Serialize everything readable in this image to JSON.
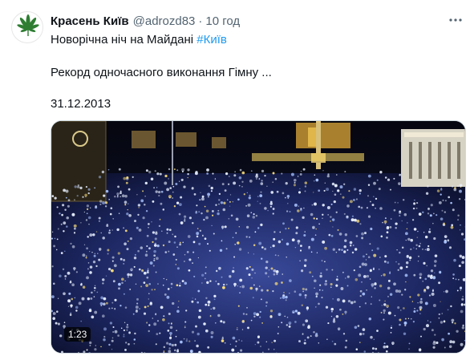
{
  "tweet": {
    "author_name": "Красень Київ",
    "handle": "@adrozd83",
    "separator": "·",
    "time": "10 год",
    "line1_text": "Новорічна ніч на Майдані ",
    "hashtag": "#Київ",
    "line2_text": "Рекорд одночасного виконання Гімну ...",
    "line3_text": "31.12.2013",
    "avatar_icon": "cannabis-leaf-icon",
    "more_icon": "more-options-icon"
  },
  "media": {
    "duration": "1:23",
    "play_state": "video-thumbnail"
  },
  "colors": {
    "hashtag": "#1d9bf0",
    "secondary_text": "#536471",
    "avatar_leaf": "#2e7d32"
  }
}
